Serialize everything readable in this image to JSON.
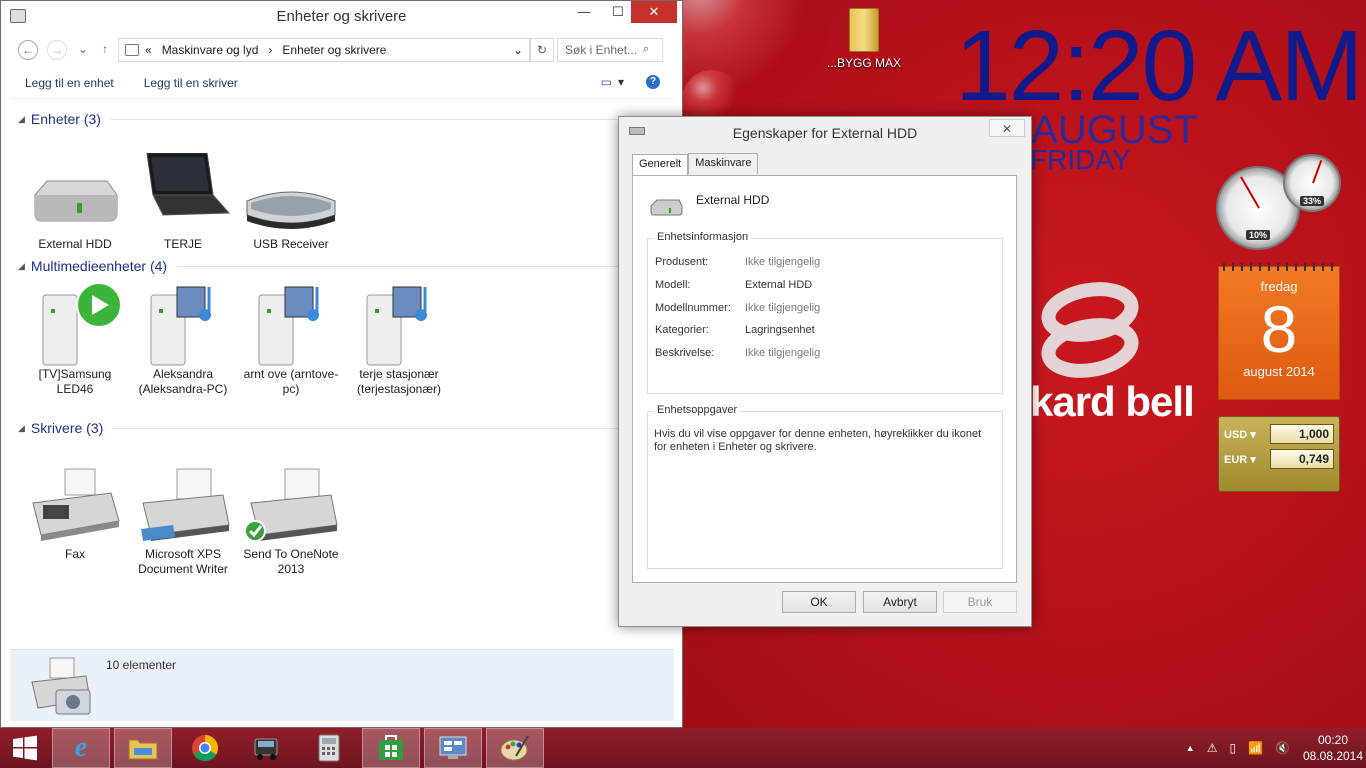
{
  "explorer": {
    "title": "Enheter og skrivere",
    "window_buttons": {
      "minimize": "—",
      "maximize": "☐",
      "close": "✕"
    },
    "address": {
      "overflow": "«",
      "segments": [
        "Maskinvare og lyd",
        "›",
        "Enheter og skrivere"
      ],
      "dropdown": "⌄",
      "refresh": "↻"
    },
    "search": {
      "placeholder": "Søk i Enhet..."
    },
    "nav": {
      "back": "←",
      "forward": "→",
      "recent": "⌄",
      "up": "↑"
    },
    "commands": [
      "Legg til en enhet",
      "Legg til en skriver"
    ],
    "view_icons": {
      "view": "▭",
      "dropdown": "▾",
      "help": "?"
    },
    "groups": [
      {
        "title": "Enheter (3)",
        "items": [
          {
            "label": "External HDD"
          },
          {
            "label": "TERJE"
          },
          {
            "label": "USB Receiver"
          }
        ]
      },
      {
        "title": "Multimedieenheter (4)",
        "items": [
          {
            "label": "[TV]Samsung LED46"
          },
          {
            "label": "Aleksandra (Aleksandra-PC)"
          },
          {
            "label": "arnt ove (arntove-pc)"
          },
          {
            "label": "terje stasjonær (terjestasjonær)"
          }
        ]
      },
      {
        "title": "Skrivere (3)",
        "items": [
          {
            "label": "Fax"
          },
          {
            "label": "Microsoft XPS Document Writer"
          },
          {
            "label": "Send To OneNote 2013"
          }
        ]
      }
    ],
    "status": "10 elementer"
  },
  "dialog": {
    "title": "Egenskaper for External HDD",
    "close": "✕",
    "tabs": [
      "Generelt",
      "Maskinvare"
    ],
    "device_name": "External HDD",
    "info_legend": "Enhetsinformasjon",
    "properties": [
      {
        "key": "Produsent:",
        "value": "Ikke tilgjengelig",
        "available": false
      },
      {
        "key": "Modell:",
        "value": "External HDD",
        "available": true
      },
      {
        "key": "Modellnummer:",
        "value": "Ikke tilgjengelig",
        "available": false
      },
      {
        "key": "Kategorier:",
        "value": "Lagringsenhet",
        "available": true
      },
      {
        "key": "Beskrivelse:",
        "value": "Ikke tilgjengelig",
        "available": false
      }
    ],
    "tasks_legend": "Enhetsoppgaver",
    "tasks_text": "Hvis du vil vise oppgaver for denne enheten, høyreklikker du ikonet for enheten i Enheter og skrivere.",
    "buttons": {
      "ok": "OK",
      "cancel": "Avbryt",
      "apply": "Bruk"
    }
  },
  "desktop": {
    "icon_label": "...BYGG MAX",
    "clock_time": "12:20 AM",
    "clock_date": "8 AUGUST",
    "clock_day": "FRIDAY",
    "brand": "kard bell",
    "gauges": [
      {
        "value": "10%"
      },
      {
        "value": "33%"
      }
    ],
    "calendar": {
      "weekday": "fredag",
      "day": "8",
      "month": "august 2014"
    },
    "currency": [
      {
        "code": "USD ▾",
        "value": "1,000"
      },
      {
        "code": "EUR ▾",
        "value": "0,749"
      }
    ]
  },
  "taskbar": {
    "apps": [
      "windows-logo",
      "internet-explorer",
      "file-explorer",
      "chrome",
      "truck-app",
      "calculator",
      "store",
      "control-panel",
      "paint"
    ],
    "tray_arrow": "▲",
    "time": "00:20",
    "date": "08.08.2014"
  }
}
